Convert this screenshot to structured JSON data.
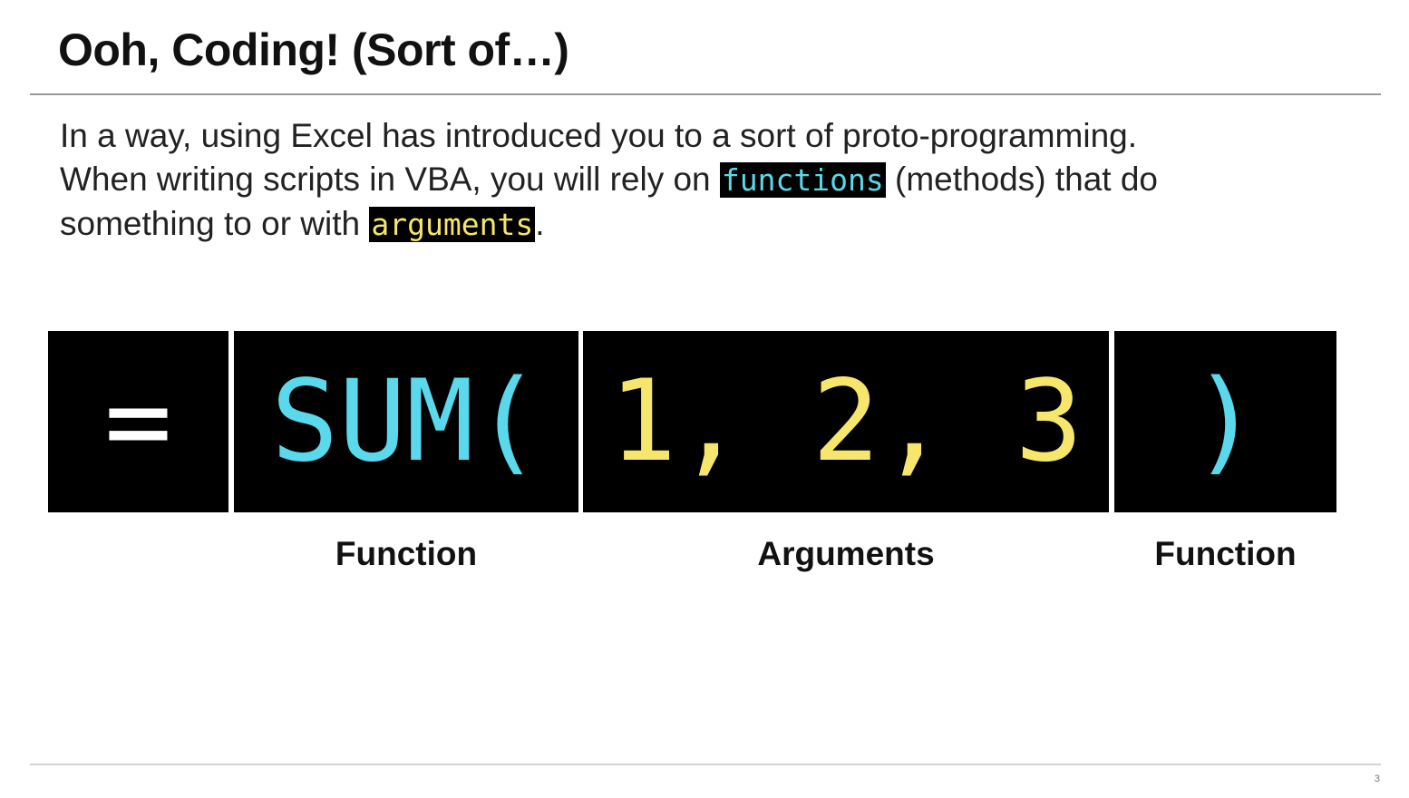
{
  "slide": {
    "title": "Ooh, Coding! (Sort of…)",
    "page_number": "3"
  },
  "body": {
    "line1": "In a way, using Excel has introduced you to a sort of proto-programming.",
    "line2_before": "When writing scripts in VBA, you will rely on ",
    "line2_code": "functions",
    "line2_after": " (methods) that do",
    "line3_before": "something to or with ",
    "line3_code": "arguments",
    "line3_after": "."
  },
  "formula": {
    "equals": "=",
    "function_open": "SUM(",
    "arguments": "1, 2, 3",
    "function_close": ")"
  },
  "labels": {
    "function_open": "Function",
    "arguments": "Arguments",
    "function_close": "Function"
  },
  "colors": {
    "function": "#5ad8ec",
    "arguments": "#f6e66c",
    "box_background": "#000000"
  }
}
